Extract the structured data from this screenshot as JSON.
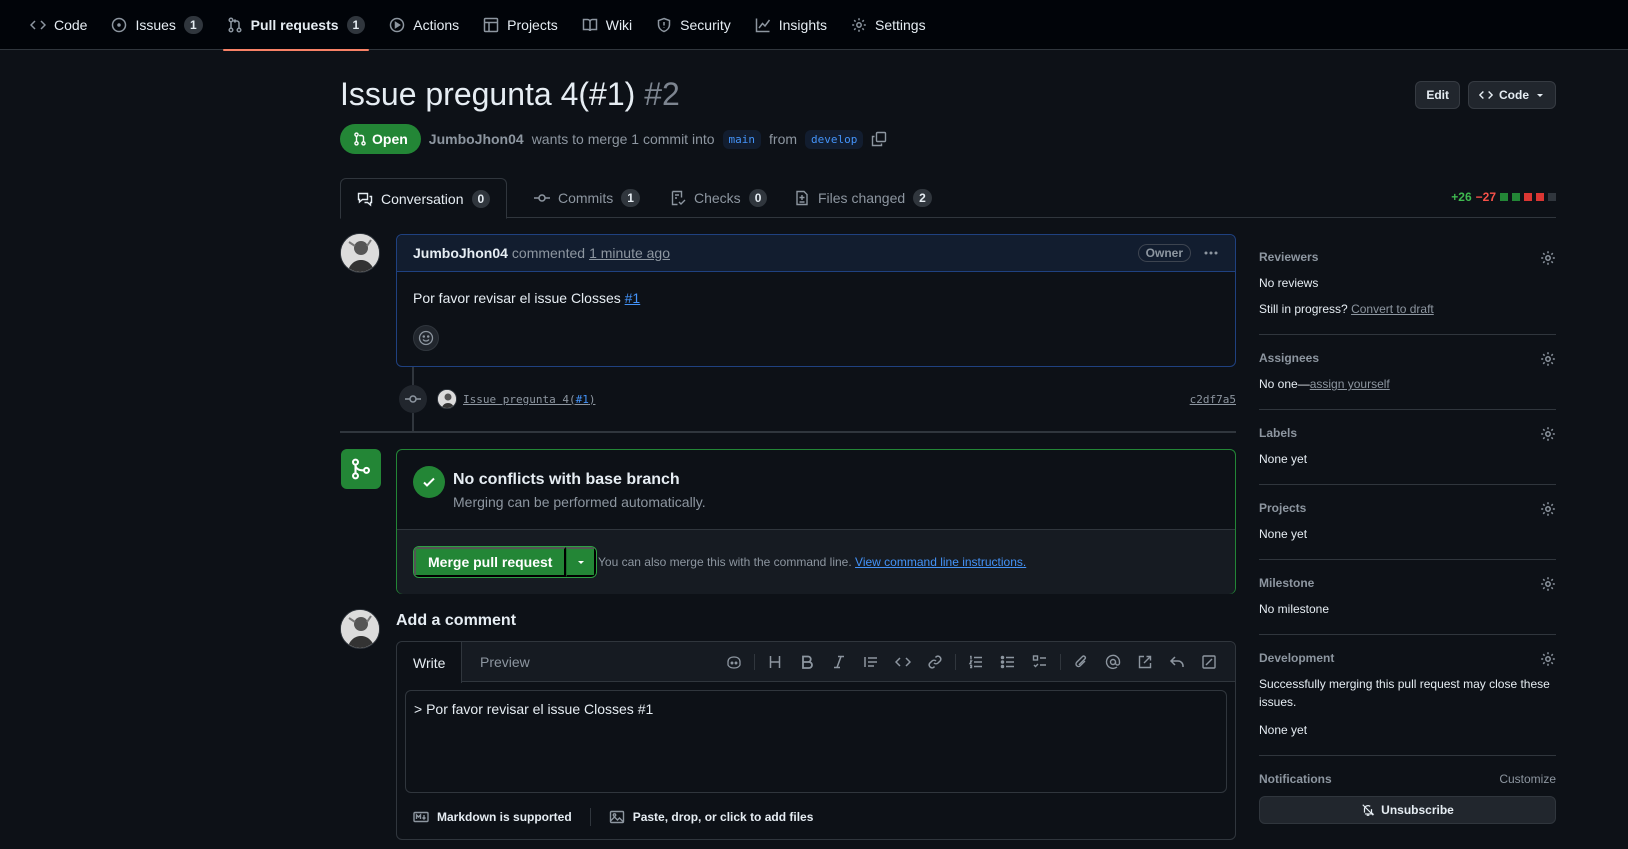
{
  "nav": {
    "items": [
      {
        "label": "Code",
        "icon": "code-icon"
      },
      {
        "label": "Issues",
        "icon": "issue-opened-icon",
        "count": "1"
      },
      {
        "label": "Pull requests",
        "icon": "git-pull-request-icon",
        "count": "1",
        "active": true
      },
      {
        "label": "Actions",
        "icon": "play-icon"
      },
      {
        "label": "Projects",
        "icon": "table-icon"
      },
      {
        "label": "Wiki",
        "icon": "book-icon"
      },
      {
        "label": "Security",
        "icon": "shield-icon"
      },
      {
        "label": "Insights",
        "icon": "graph-icon"
      },
      {
        "label": "Settings",
        "icon": "gear-icon"
      }
    ]
  },
  "pr": {
    "title": "Issue pregunta 4(#1)",
    "number": "#2",
    "state": "Open",
    "author": "JumboJhon04",
    "merge_text_1": "wants to merge 1 commit into",
    "base": "main",
    "merge_text_2": "from",
    "head": "develop",
    "edit_label": "Edit",
    "code_label": "Code"
  },
  "tabs": [
    {
      "label": "Conversation",
      "count": "0"
    },
    {
      "label": "Commits",
      "count": "1"
    },
    {
      "label": "Checks",
      "count": "0"
    },
    {
      "label": "Files changed",
      "count": "2"
    }
  ],
  "diffstat": {
    "additions": "+26",
    "deletions": "−27"
  },
  "comment": {
    "author": "JumboJhon04",
    "action": "commented",
    "time": "1 minute ago",
    "badge": "Owner",
    "body": "Por favor revisar el issue Closses",
    "ref": "#1"
  },
  "commit": {
    "message": "Issue pregunta 4(",
    "ref": "#1",
    "message_end": ")",
    "sha": "c2df7a5"
  },
  "merge": {
    "title": "No conflicts with base branch",
    "subtitle": "Merging can be performed automatically.",
    "button": "Merge pull request",
    "note": "You can also merge this with the command line.",
    "note_link": "View command line instructions."
  },
  "add_comment": {
    "title": "Add a comment",
    "write_tab": "Write",
    "preview_tab": "Preview",
    "text": "> Por favor revisar el issue Closses #1",
    "markdown": "Markdown is supported",
    "attach": "Paste, drop, or click to add files"
  },
  "sidebar": {
    "reviewers": {
      "title": "Reviewers",
      "value": "No reviews",
      "progress": "Still in progress?",
      "draft_link": "Convert to draft"
    },
    "assignees": {
      "title": "Assignees",
      "value": "No one—",
      "link": "assign yourself"
    },
    "labels": {
      "title": "Labels",
      "value": "None yet"
    },
    "projects": {
      "title": "Projects",
      "value": "None yet"
    },
    "milestone": {
      "title": "Milestone",
      "value": "No milestone"
    },
    "development": {
      "title": "Development",
      "desc": "Successfully merging this pull request may close these issues.",
      "value": "None yet"
    },
    "notifications": {
      "title": "Notifications",
      "customize": "Customize",
      "button": "Unsubscribe"
    }
  },
  "colors": {
    "accent": "#238636",
    "link": "#4493f8",
    "tab_underline": "#f78166",
    "background": "#0d1117"
  }
}
